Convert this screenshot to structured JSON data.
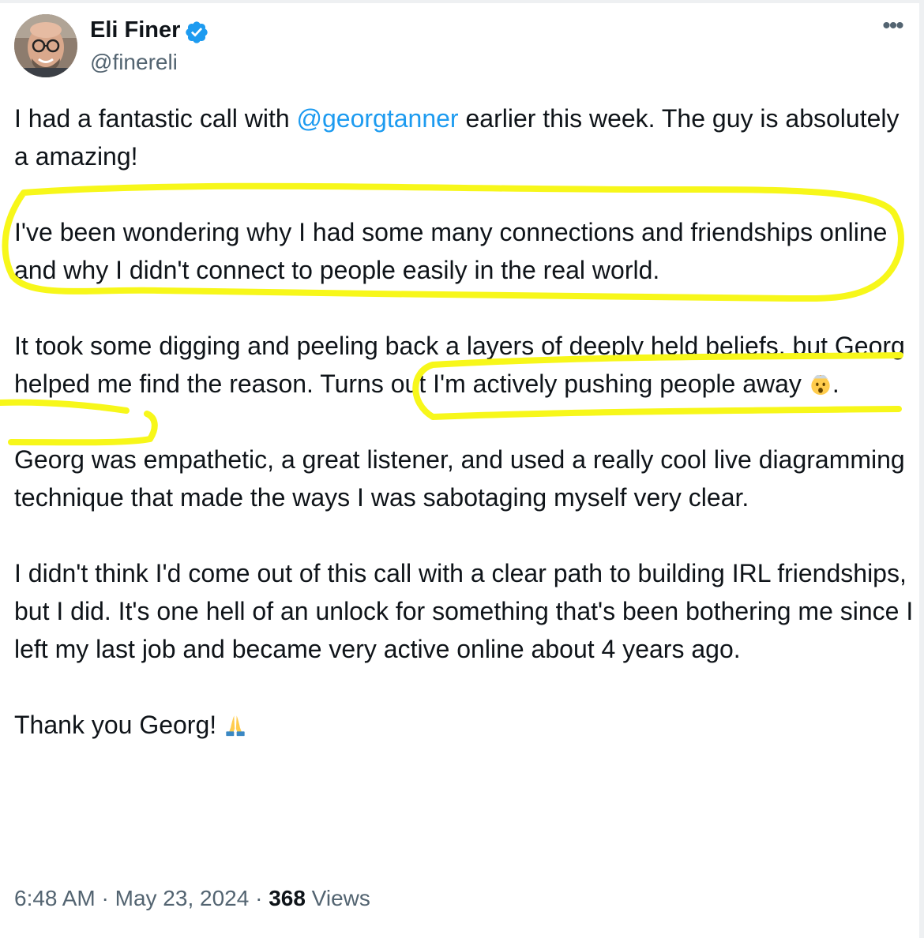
{
  "author": {
    "name": "Eli Finer",
    "handle": "@finereli",
    "avatar_icon": "avatar-photo",
    "verified_icon": "verified-badge-icon",
    "verified_color": "#1d9bf0"
  },
  "menu": {
    "more_label": "•••"
  },
  "tweet": {
    "p1_before": "I had a fantastic call with ",
    "p1_mention": "@georgtanner",
    "p1_after": " earlier this week. The guy is absolutely a amazing!",
    "p2": "I've been wondering why I had some many connections and friendships online and why I didn't connect to people easily in the real world.",
    "p3_before": "It took some digging and peeling back a layers of deeply held beliefs, but Georg helped me find the reason. Turns out I'm actively pushing people away ",
    "p3_emoji": "exploding-head-emoji",
    "p3_after": ".",
    "p4": "Georg was empathetic, a great listener, and used a really cool live diagramming technique that made the ways I was sabotaging myself very clear.",
    "p5": "I didn't think I'd come out of this call with a clear path to building IRL friendships, but I did. It's one hell of an unlock for something that's been bothering me since I left my last job and became very active online about 4 years ago.",
    "p6": "Thank you Georg! ",
    "p6_emoji": "folded-hands-emoji"
  },
  "meta": {
    "time": "6:48 AM",
    "sep1": " · ",
    "date": "May 23, 2024",
    "sep2": " · ",
    "views_count": "368",
    "views_label": " Views"
  },
  "colors": {
    "mention": "#1d9bf0",
    "muted": "#536471",
    "text": "#0f1419",
    "highlighter": "#f7f71a"
  }
}
